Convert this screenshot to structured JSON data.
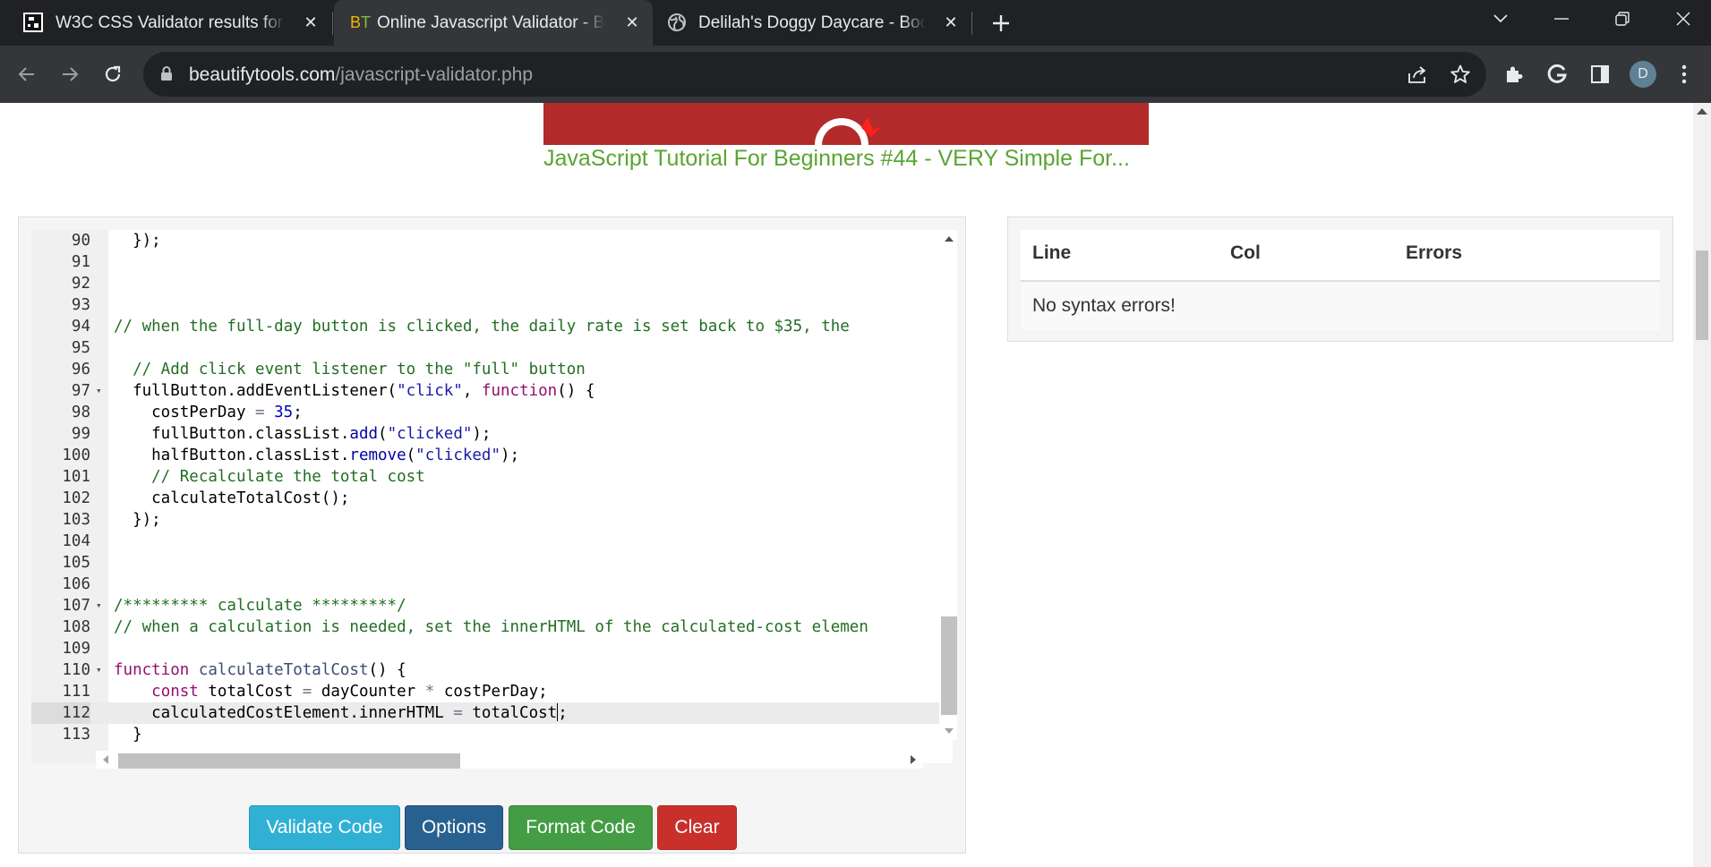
{
  "browser": {
    "tabs": [
      {
        "title": "W3C CSS Validator results for",
        "active": false,
        "favicon": "w3c-icon"
      },
      {
        "title": "Online Javascript Validator - B",
        "active": true,
        "favicon": "bt-icon"
      },
      {
        "title": "Delilah's Doggy Daycare - Boo",
        "active": false,
        "favicon": "globe-icon"
      }
    ],
    "bt_favicon_b": "B",
    "bt_favicon_t": "T",
    "new_tab_symbol": "+",
    "close_symbol": "✕",
    "url_host": "beautifytools.com",
    "url_path": "/javascript-validator.php",
    "profile_initial": "D"
  },
  "page": {
    "video_title": "JavaScript Tutorial For Beginners #44 - VERY Simple For...",
    "editor": {
      "lines": [
        {
          "num": "90",
          "text": "  });",
          "fold": false
        },
        {
          "num": "91",
          "text": "",
          "fold": false
        },
        {
          "num": "92",
          "text": "",
          "fold": false
        },
        {
          "num": "93",
          "text": "",
          "fold": false
        },
        {
          "num": "94",
          "text": "// when the full-day button is clicked, the daily rate is set back to $35, the ",
          "fold": false
        },
        {
          "num": "95",
          "text": "",
          "fold": false
        },
        {
          "num": "96",
          "text": "  // Add click event listener to the \"full\" button",
          "fold": false
        },
        {
          "num": "97",
          "text": "  fullButton.addEventListener(\"click\", function() {",
          "fold": true
        },
        {
          "num": "98",
          "text": "    costPerDay = 35;",
          "fold": false
        },
        {
          "num": "99",
          "text": "    fullButton.classList.add(\"clicked\");",
          "fold": false
        },
        {
          "num": "100",
          "text": "    halfButton.classList.remove(\"clicked\");",
          "fold": false
        },
        {
          "num": "101",
          "text": "    // Recalculate the total cost",
          "fold": false
        },
        {
          "num": "102",
          "text": "    calculateTotalCost();",
          "fold": false
        },
        {
          "num": "103",
          "text": "  });",
          "fold": false
        },
        {
          "num": "104",
          "text": "",
          "fold": false
        },
        {
          "num": "105",
          "text": "",
          "fold": false
        },
        {
          "num": "106",
          "text": "",
          "fold": false
        },
        {
          "num": "107",
          "text": "/********* calculate *********/",
          "fold": true
        },
        {
          "num": "108",
          "text": "// when a calculation is needed, set the innerHTML of the calculated-cost elemen",
          "fold": false
        },
        {
          "num": "109",
          "text": "",
          "fold": false
        },
        {
          "num": "110",
          "text": "function calculateTotalCost() {",
          "fold": true
        },
        {
          "num": "111",
          "text": "    const totalCost = dayCounter * costPerDay;",
          "fold": false
        },
        {
          "num": "112",
          "text": "    calculatedCostElement.innerHTML = totalCost;",
          "fold": false,
          "active": true
        },
        {
          "num": "113",
          "text": "  }",
          "fold": false
        }
      ]
    },
    "buttons": {
      "validate": "Validate Code",
      "options": "Options",
      "format": "Format Code",
      "clear": "Clear"
    },
    "results": {
      "col_line": "Line",
      "col_col": "Col",
      "col_errors": "Errors",
      "message": "No syntax errors!"
    }
  },
  "colors": {
    "validate_button": "#31b0d5",
    "options_button": "#286090",
    "format_button": "#449d44",
    "clear_button": "#c9302c",
    "video_title": "#59a531",
    "video_banner": "#b22a2a"
  }
}
